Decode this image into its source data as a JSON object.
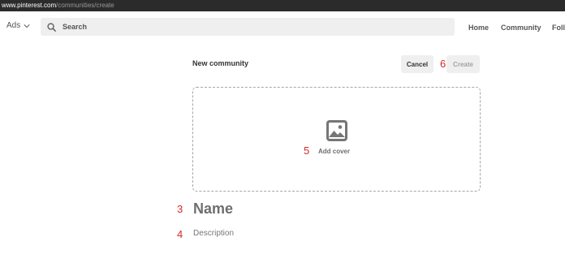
{
  "browser": {
    "url_host": "www.pinterest.com",
    "url_path": "/communities/create"
  },
  "header": {
    "ads_label": "Ads",
    "search_placeholder": "Search",
    "nav": [
      "Home",
      "Community",
      "Foll"
    ]
  },
  "form": {
    "title": "New community",
    "cancel_label": "Cancel",
    "create_label": "Create",
    "add_cover_label": "Add cover",
    "name_placeholder": "Name",
    "description_placeholder": "Description"
  },
  "annotations": [
    "3",
    "4",
    "5",
    "6"
  ],
  "icons": {
    "ads_dropdown": "chevron-down-icon",
    "search": "search-icon",
    "cover": "image-icon"
  },
  "colors": {
    "url_bar_bg": "#2b2b2b",
    "button_bg": "#efefef",
    "annotation_red": "#d42a2a",
    "dashed_border": "#a6a6a6"
  }
}
